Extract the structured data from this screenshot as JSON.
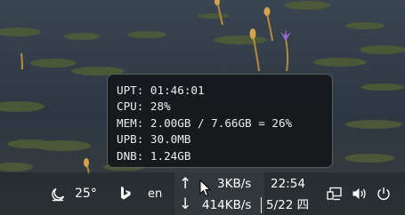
{
  "sysmon": {
    "rows": [
      "UPT: 01:46:01",
      "CPU: 28%",
      "MEM: 2.00GB / 7.66GB = 26%",
      "UPB: 30.0MB",
      "DNB: 1.24GB"
    ]
  },
  "taskbar": {
    "weather": {
      "icon": "weather-icon",
      "temperature": "25°"
    },
    "bing": {
      "icon": "bing-icon",
      "label": "b"
    },
    "language": "en",
    "network_speed": {
      "up_arrow": "↑",
      "down_arrow": "↓",
      "upload": "3KB/s",
      "download": "414KB/s"
    },
    "clock": {
      "time": "22:54",
      "date": "5/22 四"
    },
    "tray_icons": [
      "network-icon",
      "volume-icon",
      "power-icon"
    ]
  },
  "colors": {
    "tooltip_bg": "#14171a",
    "tooltip_border": "#969696",
    "text": "#eeeeee",
    "water": "#2b3540",
    "lily_pad": "#4d5a38"
  }
}
